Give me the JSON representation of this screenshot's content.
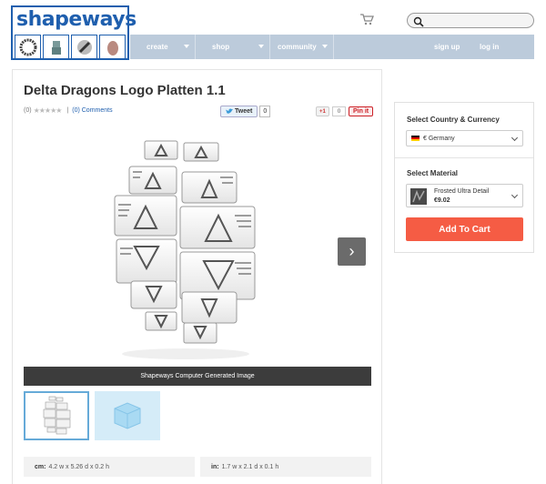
{
  "header": {
    "logo_text": "shapeways",
    "logo_thumbnails": [
      "ring-icon",
      "robot-figure-icon",
      "wrench-icon",
      "egg-icon"
    ],
    "cart_icon": "cart-icon",
    "search_placeholder": ""
  },
  "nav": {
    "items": [
      {
        "label": "create",
        "has_dropdown": true
      },
      {
        "label": "shop",
        "has_dropdown": true
      },
      {
        "label": "community",
        "has_dropdown": true
      }
    ],
    "sign_up": "sign up",
    "log_in": "log in"
  },
  "product": {
    "title": "Delta Dragons Logo Platten 1.1",
    "rating_count": "(0)",
    "stars": "★★★★★",
    "separator": "|",
    "comments": "(0) Comments",
    "tweet_label": "Tweet",
    "tweet_count": "0",
    "gplus_label": "+1",
    "gplus_count": "0",
    "pin_label": "Pin it",
    "next_arrow": "›",
    "image_caption": "Shapeways Computer Generated Image",
    "dims": [
      {
        "unit": "cm:",
        "value": "4.2 w x 5.26 d x 0.2 h"
      },
      {
        "unit": "in:",
        "value": "1.7 w x 2.1 d x 0.1 h"
      }
    ]
  },
  "buy": {
    "country_label": "Select Country & Currency",
    "country_value": "€ Germany",
    "material_label": "Select Material",
    "material_name": "Frosted Ultra Detail",
    "material_price": "€9.02",
    "add_to_cart": "Add To Cart"
  },
  "colors": {
    "brand_blue": "#1f5fae",
    "nav_bg": "#bccbdb",
    "cta": "#f55c44",
    "caption_bg": "#3c3c3c"
  }
}
